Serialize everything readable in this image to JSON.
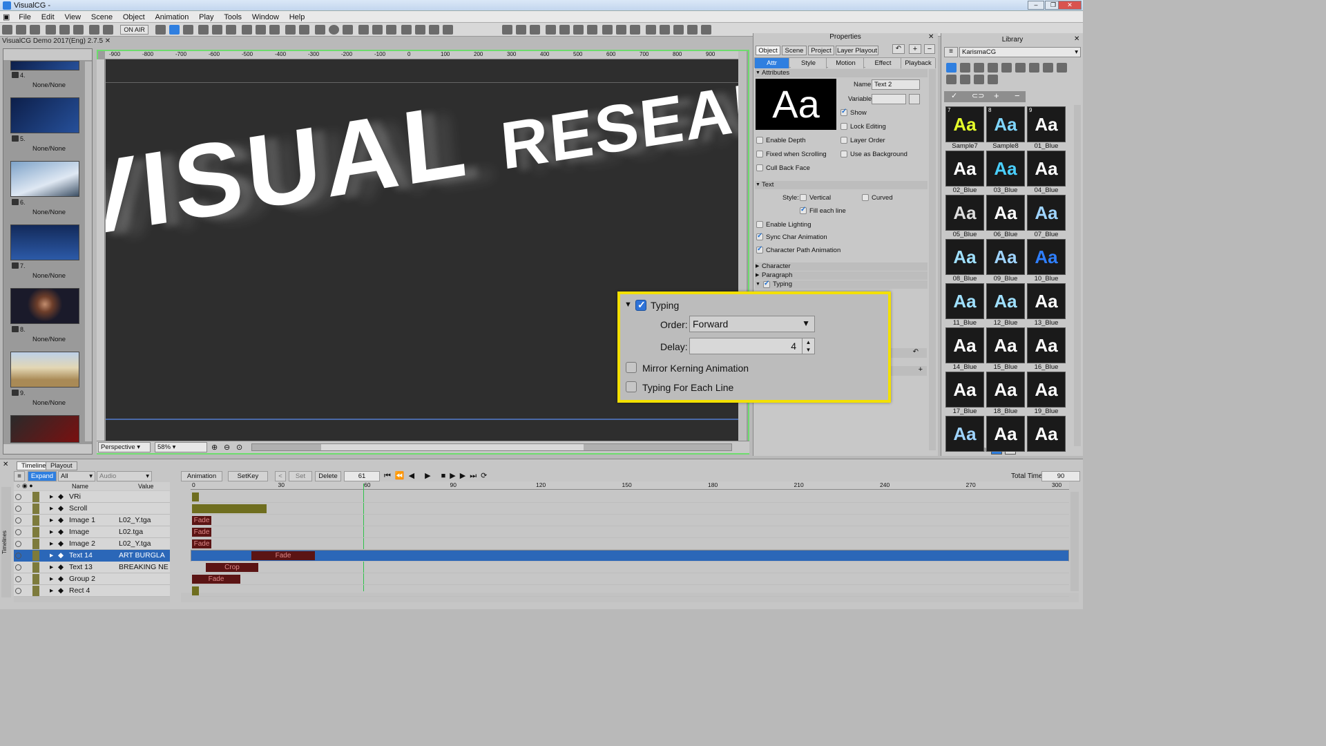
{
  "window": {
    "title": "VisualCG -"
  },
  "menu": [
    "File",
    "Edit",
    "View",
    "Scene",
    "Object",
    "Animation",
    "Play",
    "Tools",
    "Window",
    "Help"
  ],
  "toolbar": {
    "onair": "ON AIR"
  },
  "document_tab": "VisualCG Demo 2017(Eng) 2.7.5",
  "thumbnails": [
    {
      "num": "4.",
      "label": "None/None"
    },
    {
      "num": "5.",
      "label": "None/None"
    },
    {
      "num": "6.",
      "label": "None/None"
    },
    {
      "num": "7.",
      "label": "None/None"
    },
    {
      "num": "8.",
      "label": "None/None"
    },
    {
      "num": "9.",
      "label": "None/None"
    }
  ],
  "ruler": {
    "h": [
      "-900",
      "-800",
      "-700",
      "-600",
      "-500",
      "-400",
      "-300",
      "-200",
      "-100",
      "0",
      "100",
      "200",
      "300",
      "400",
      "500",
      "600",
      "700",
      "800",
      "900"
    ]
  },
  "canvas": {
    "text_big": "VISUAL",
    "text_small": "RESEARCH"
  },
  "viewbar": {
    "mode": "Perspective",
    "zoom": "58%"
  },
  "properties": {
    "title": "Properties",
    "tabs": [
      "Object",
      "Scene",
      "Project",
      "Layer Playout"
    ],
    "subtabs": [
      "Attr",
      "Style",
      "Motion",
      "Effect",
      "Playback"
    ],
    "attributes_header": "Attributes",
    "preview": "Aa",
    "name_label": "Name:",
    "name_value": "Text 2",
    "variable_label": "Variable:",
    "checks": {
      "show": "Show",
      "lock_editing": "Lock Editing",
      "enable_depth": "Enable Depth",
      "layer_order": "Layer Order",
      "fixed_scrolling": "Fixed when Scrolling",
      "use_background": "Use as Background",
      "cull_back": "Cull Back Face"
    },
    "text_header": "Text",
    "style_label": "Style:",
    "vertical": "Vertical",
    "curved": "Curved",
    "fill_each_line": "Fill each line",
    "enable_lighting": "Enable Lighting",
    "sync_char": "Sync Char Animation",
    "char_path": "Character Path Animation",
    "character": "Character",
    "paragraph": "Paragraph",
    "typing": "Typing"
  },
  "typing_popup": {
    "title": "Typing",
    "order_label": "Order:",
    "order_value": "Forward",
    "delay_label": "Delay:",
    "delay_value": "4",
    "mirror": "Mirror Kerning Animation",
    "each_line": "Typing For Each Line"
  },
  "library": {
    "title": "Library",
    "source": "KarismaCG",
    "items": [
      {
        "num": "7",
        "label": "Sample7",
        "color": "#e6ff2a"
      },
      {
        "num": "8",
        "label": "Sample8",
        "color": "#7fd6ff"
      },
      {
        "num": "9",
        "label": "01_Blue",
        "color": "#ffffff"
      },
      {
        "num": "",
        "label": "02_Blue",
        "color": "#ffffff"
      },
      {
        "num": "",
        "label": "03_Blue",
        "color": "#4ad0ff"
      },
      {
        "num": "",
        "label": "04_Blue",
        "color": "#ffffff"
      },
      {
        "num": "",
        "label": "05_Blue",
        "color": "#dddddd"
      },
      {
        "num": "",
        "label": "06_Blue",
        "color": "#ffffff"
      },
      {
        "num": "",
        "label": "07_Blue",
        "color": "#9fd4ff"
      },
      {
        "num": "",
        "label": "08_Blue",
        "color": "#9fe0ff"
      },
      {
        "num": "",
        "label": "09_Blue",
        "color": "#9fd4ff"
      },
      {
        "num": "",
        "label": "10_Blue",
        "color": "#2f7fff"
      },
      {
        "num": "",
        "label": "11_Blue",
        "color": "#9fe0ff"
      },
      {
        "num": "",
        "label": "12_Blue",
        "color": "#9fe0ff"
      },
      {
        "num": "",
        "label": "13_Blue",
        "color": "#ffffff"
      },
      {
        "num": "",
        "label": "14_Blue",
        "color": "#ffffff"
      },
      {
        "num": "",
        "label": "15_Blue",
        "color": "#ffffff"
      },
      {
        "num": "",
        "label": "16_Blue",
        "color": "#ffffff"
      },
      {
        "num": "",
        "label": "17_Blue",
        "color": "#ffffff"
      },
      {
        "num": "",
        "label": "18_Blue",
        "color": "#ffffff"
      },
      {
        "num": "",
        "label": "19_Blue",
        "color": "#ffffff"
      },
      {
        "num": "",
        "label": "",
        "color": "#9fd4ff"
      },
      {
        "num": "",
        "label": "",
        "color": "#ffffff"
      },
      {
        "num": "",
        "label": "",
        "color": "#ffffff"
      }
    ]
  },
  "timeline": {
    "tabs": [
      "Timeline",
      "Playout"
    ],
    "expand": "Expand",
    "filter": "All",
    "audio": "Audio",
    "animation": "Animation",
    "setkey": "SetKey",
    "set": "Set",
    "delete": "Delete",
    "frame": "61",
    "total_time_label": "Total Time:",
    "total_time": "90",
    "col_name": "Name",
    "col_value": "Value",
    "ticks": [
      "0",
      "30",
      "60",
      "90",
      "120",
      "150",
      "180",
      "210",
      "240",
      "270",
      "300"
    ],
    "layers": [
      {
        "name": "VRi",
        "value": ""
      },
      {
        "name": "Scroll",
        "value": ""
      },
      {
        "name": "Image 1",
        "value": "L02_Y.tga"
      },
      {
        "name": "Image",
        "value": "L02.tga"
      },
      {
        "name": "Image 2",
        "value": "L02_Y.tga"
      },
      {
        "name": "Text 14",
        "value": "ART BURGLA"
      },
      {
        "name": "Text 13",
        "value": "BREAKING NE"
      },
      {
        "name": "Group 2",
        "value": ""
      },
      {
        "name": "Rect 4",
        "value": ""
      }
    ],
    "bars": {
      "fade": "Fade",
      "crop": "Crop"
    }
  }
}
